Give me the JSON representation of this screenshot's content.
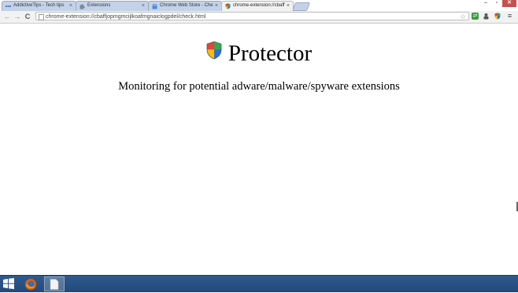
{
  "browser": {
    "tabs": [
      {
        "title": "AddictiveTips - Tech tips",
        "icon": "addictivetips-icon"
      },
      {
        "title": "Extensions",
        "icon": "puzzle-icon"
      },
      {
        "title": "Chrome Web Store - Che",
        "icon": "webstore-icon"
      },
      {
        "title": "chrome-extension://cbaff",
        "icon": "shield-icon",
        "active": true
      }
    ],
    "tab_close_glyph": "×",
    "address": "chrome-extension://cbaffjopmgmcijlkoafmgnaiclogpdel/check.html",
    "nav": {
      "back_glyph": "←",
      "forward_glyph": "→",
      "reload_glyph": "C"
    },
    "menu_glyph": "≡",
    "window_controls": {
      "minimize": "–",
      "maximize": "▫",
      "close": "✕"
    }
  },
  "page": {
    "title": "Protector",
    "subtitle": "Monitoring for potential adware/malware/spyware extensions"
  },
  "colors": {
    "tab_inactive": "#c3d2e9",
    "tab_active": "#f2f2f2",
    "taskbar": "#2f5a8d",
    "close_button": "#c7504d"
  }
}
